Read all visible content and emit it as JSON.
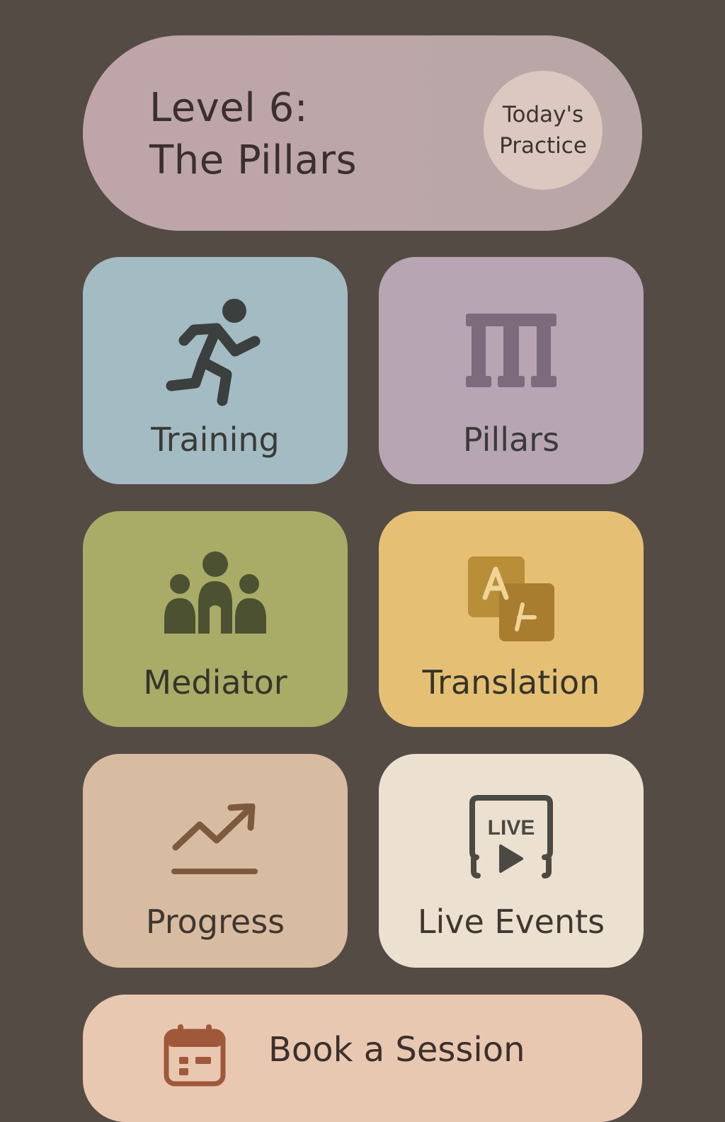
{
  "header": {
    "title_line1": "Level 6:",
    "title_line2": "The Pillars",
    "badge_line1": "Today's",
    "badge_line2": "Practice"
  },
  "tiles": [
    {
      "label": "Training",
      "icon": "running-person-icon",
      "color": "#a3bbc2"
    },
    {
      "label": "Pillars",
      "icon": "pillars-icon",
      "color": "#b8a5b3"
    },
    {
      "label": "Mediator",
      "icon": "group-people-icon",
      "color": "#a8ac67"
    },
    {
      "label": "Translation",
      "icon": "translate-icon",
      "color": "#e5c074"
    },
    {
      "label": "Progress",
      "icon": "trending-up-icon",
      "color": "#d8bca2"
    },
    {
      "label": "Live Events",
      "icon": "live-play-icon",
      "color": "#ece0d1",
      "icon_text": "LIVE"
    }
  ],
  "book": {
    "label": "Book a Session",
    "icon": "calendar-icon"
  },
  "colors": {
    "background": "#544b44",
    "header": "#bfa5a9",
    "badge": "#dcc8c0",
    "book_bar": "#e9c8b2"
  }
}
